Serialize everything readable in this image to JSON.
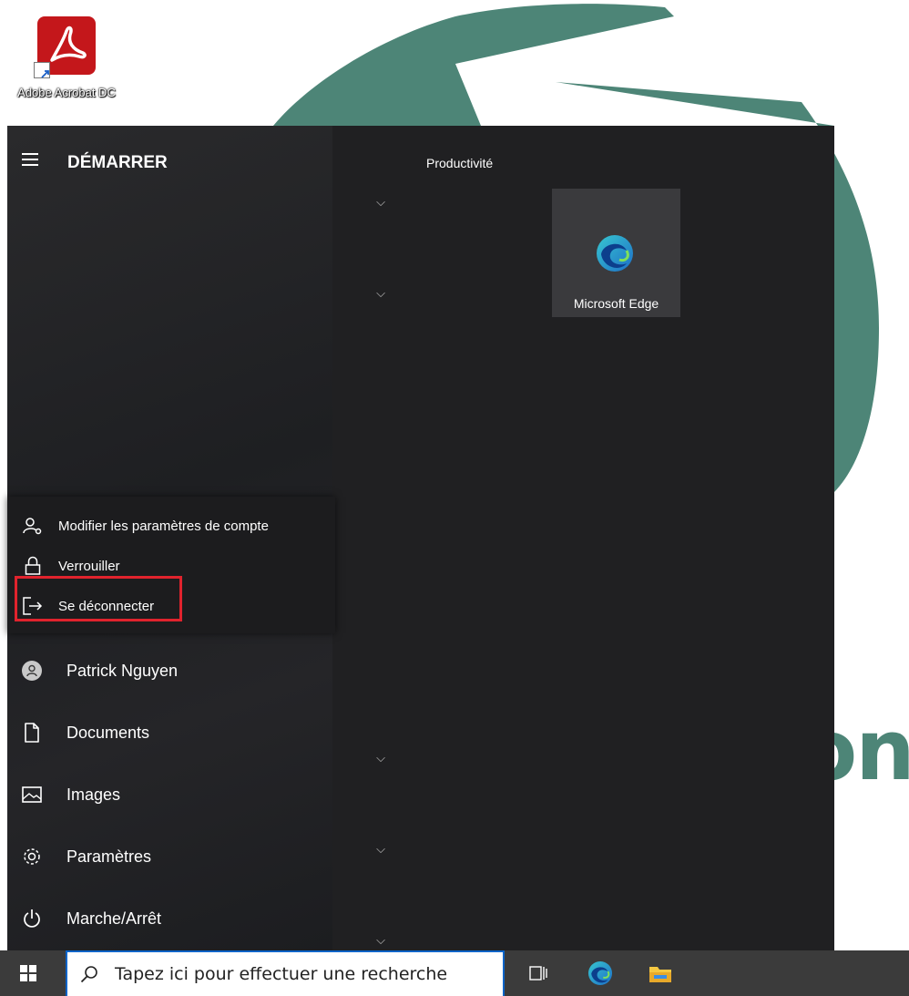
{
  "desktop": {
    "icons": [
      {
        "label": "Adobe Acrobat DC",
        "icon": "acrobat-icon"
      }
    ],
    "wallpaper_text": "on,"
  },
  "start_menu": {
    "title": "DÉMARRER",
    "group_title": "Productivité",
    "tiles": [
      {
        "label": "Microsoft Edge",
        "icon": "edge-icon"
      }
    ],
    "account_flyout": {
      "items": [
        {
          "label": "Modifier les paramètres de compte",
          "icon": "account-settings-icon"
        },
        {
          "label": "Verrouiller",
          "icon": "lock-icon"
        },
        {
          "label": "Se déconnecter",
          "icon": "sign-out-icon",
          "highlighted": true
        }
      ]
    },
    "nav": [
      {
        "label": "Patrick Nguyen",
        "icon": "user-avatar-icon"
      },
      {
        "label": "Documents",
        "icon": "document-icon"
      },
      {
        "label": "Images",
        "icon": "image-icon"
      },
      {
        "label": "Paramètres",
        "icon": "gear-icon"
      },
      {
        "label": "Marche/Arrêt",
        "icon": "power-icon"
      }
    ]
  },
  "taskbar": {
    "search_placeholder": "Tapez ici pour effectuer une recherche",
    "pinned": [
      "task-view-icon",
      "edge-icon",
      "file-explorer-icon"
    ]
  },
  "colors": {
    "wallpaper_accent": "#4d8577",
    "highlight": "#e0232d",
    "search_border": "#0a64c8"
  }
}
